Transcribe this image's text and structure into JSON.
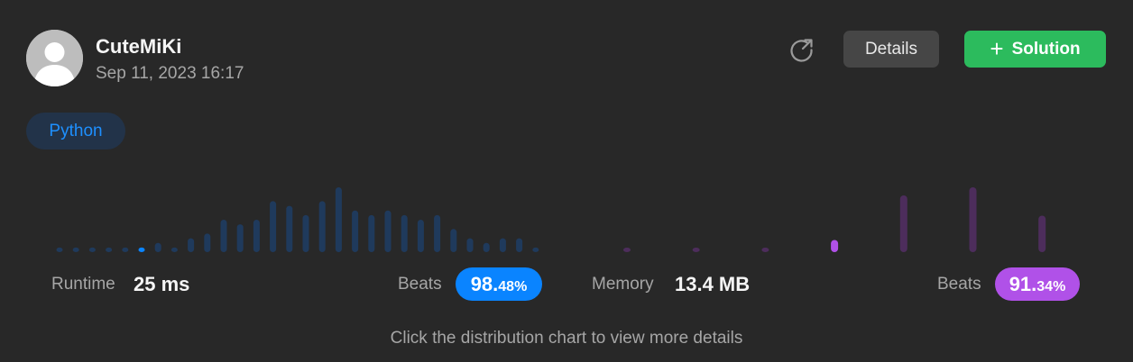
{
  "header": {
    "username": "CuteMiKi",
    "timestamp": "Sep 11, 2023 16:17",
    "avatar_icon": "default-user-avatar",
    "share_icon": "share-arrow-icon",
    "details_label": "Details",
    "solution_label": "Solution",
    "solution_icon": "plus-icon"
  },
  "language_tag": "Python",
  "colors": {
    "runtime_accent": "#0a84ff",
    "memory_accent": "#b051e8",
    "solution_green": "#2cbb5d"
  },
  "chart_data": [
    {
      "type": "bar",
      "name": "runtime-distribution",
      "values": [
        1,
        1,
        1,
        1,
        1,
        1,
        2,
        1,
        3,
        4,
        7,
        6,
        7,
        11,
        10,
        8,
        11,
        14,
        9,
        8,
        9,
        8,
        7,
        8,
        5,
        3,
        2,
        3,
        3,
        1
      ],
      "highlight_index": 5,
      "ylim": [
        0,
        14
      ]
    },
    {
      "type": "bar",
      "name": "memory-distribution",
      "values": [
        1,
        1,
        1,
        3,
        14,
        16,
        9
      ],
      "highlight_index": 3,
      "ylim": [
        0,
        16
      ]
    }
  ],
  "stats": {
    "runtime": {
      "label": "Runtime",
      "value": "25 ms",
      "beats_label": "Beats",
      "beats_int": "98.",
      "beats_frac": "48%"
    },
    "memory": {
      "label": "Memory",
      "value": "13.4 MB",
      "beats_label": "Beats",
      "beats_int": "91.",
      "beats_frac": "34%"
    }
  },
  "footnote": "Click the distribution chart to view more details"
}
